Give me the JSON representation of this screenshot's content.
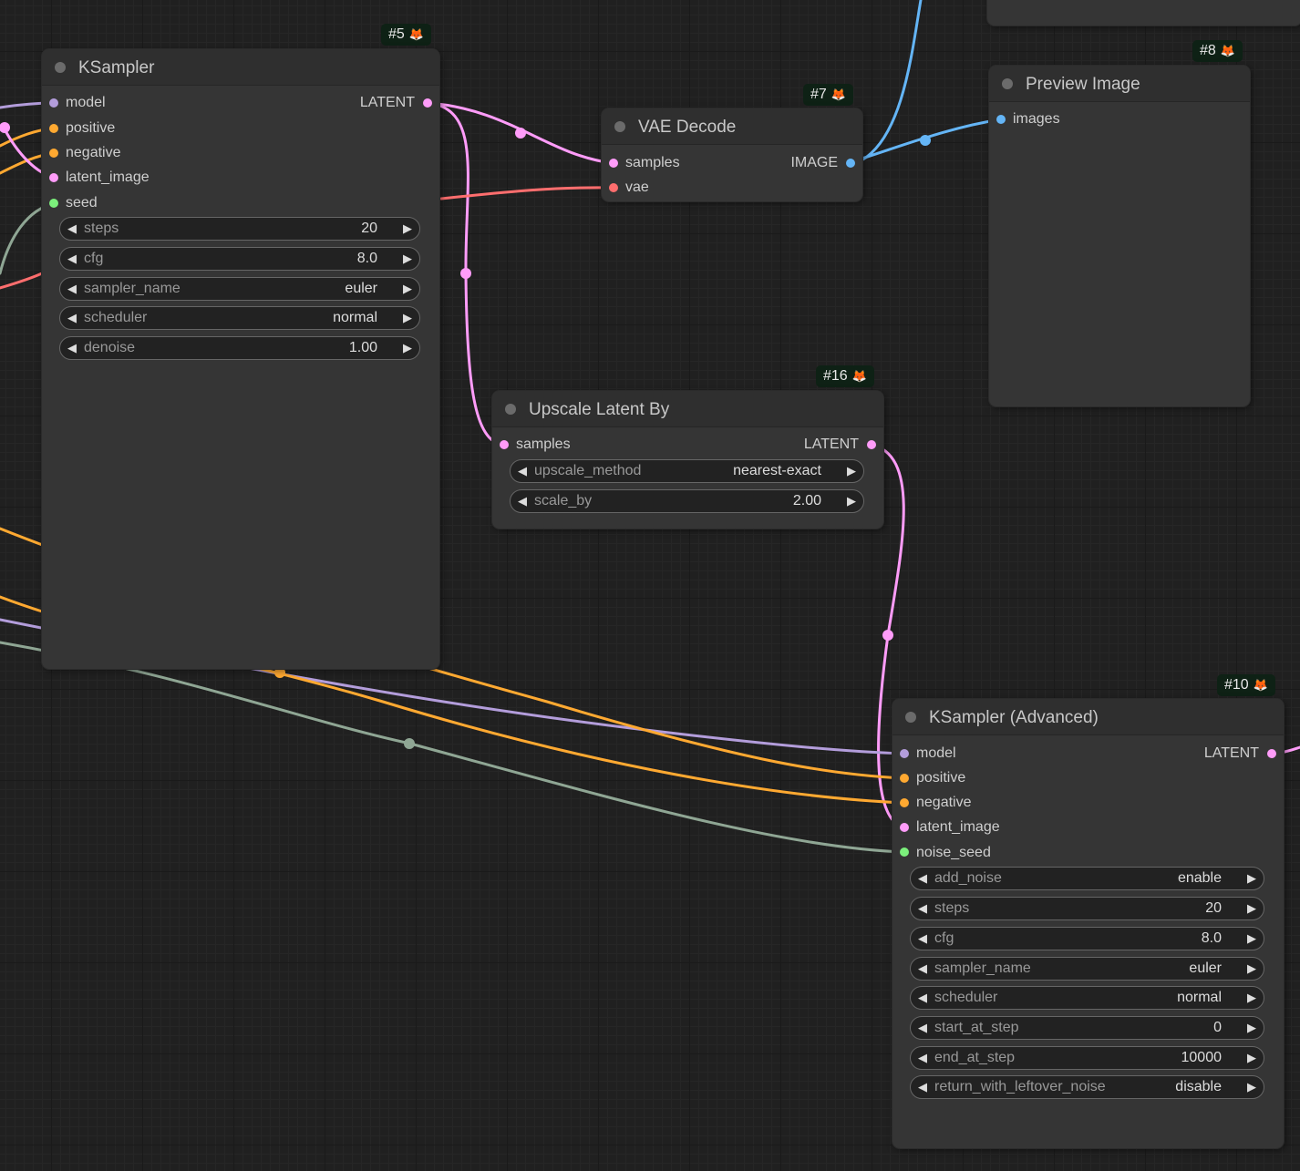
{
  "colors": {
    "model": "#b39ddb",
    "conditioning": "#ffa931",
    "latent": "#ff9cf9",
    "vae": "#ff6e6e",
    "image": "#64b5f6",
    "int": "#7cf07c",
    "seed_link": "#8fa694"
  },
  "nodes": {
    "ksampler": {
      "title": "KSampler",
      "badge": "#5",
      "badge_icon": "fox-icon",
      "inputs": [
        "model",
        "positive",
        "negative",
        "latent_image",
        "seed"
      ],
      "output": "LATENT",
      "widgets": [
        {
          "name": "steps",
          "value": "20"
        },
        {
          "name": "cfg",
          "value": "8.0"
        },
        {
          "name": "sampler_name",
          "value": "euler"
        },
        {
          "name": "scheduler",
          "value": "normal"
        },
        {
          "name": "denoise",
          "value": "1.00"
        }
      ]
    },
    "vae_decode": {
      "title": "VAE Decode",
      "badge": "#7",
      "inputs": [
        "samples",
        "vae"
      ],
      "output": "IMAGE"
    },
    "preview": {
      "title": "Preview Image",
      "badge": "#8",
      "inputs": [
        "images"
      ]
    },
    "upscale": {
      "title": "Upscale Latent By",
      "badge": "#16",
      "inputs": [
        "samples"
      ],
      "output": "LATENT",
      "widgets": [
        {
          "name": "upscale_method",
          "value": "nearest-exact"
        },
        {
          "name": "scale_by",
          "value": "2.00"
        }
      ]
    },
    "ksampler_adv": {
      "title": "KSampler (Advanced)",
      "badge": "#10",
      "inputs": [
        "model",
        "positive",
        "negative",
        "latent_image",
        "noise_seed"
      ],
      "output": "LATENT",
      "widgets": [
        {
          "name": "add_noise",
          "value": "enable"
        },
        {
          "name": "steps",
          "value": "20"
        },
        {
          "name": "cfg",
          "value": "8.0"
        },
        {
          "name": "sampler_name",
          "value": "euler"
        },
        {
          "name": "scheduler",
          "value": "normal"
        },
        {
          "name": "start_at_step",
          "value": "0"
        },
        {
          "name": "end_at_step",
          "value": "10000"
        },
        {
          "name": "return_with_leftover_noise",
          "value": "disable"
        }
      ]
    }
  },
  "widget_arrows": {
    "left": "◀",
    "right": "▶"
  },
  "badge_glyph": "🦊"
}
